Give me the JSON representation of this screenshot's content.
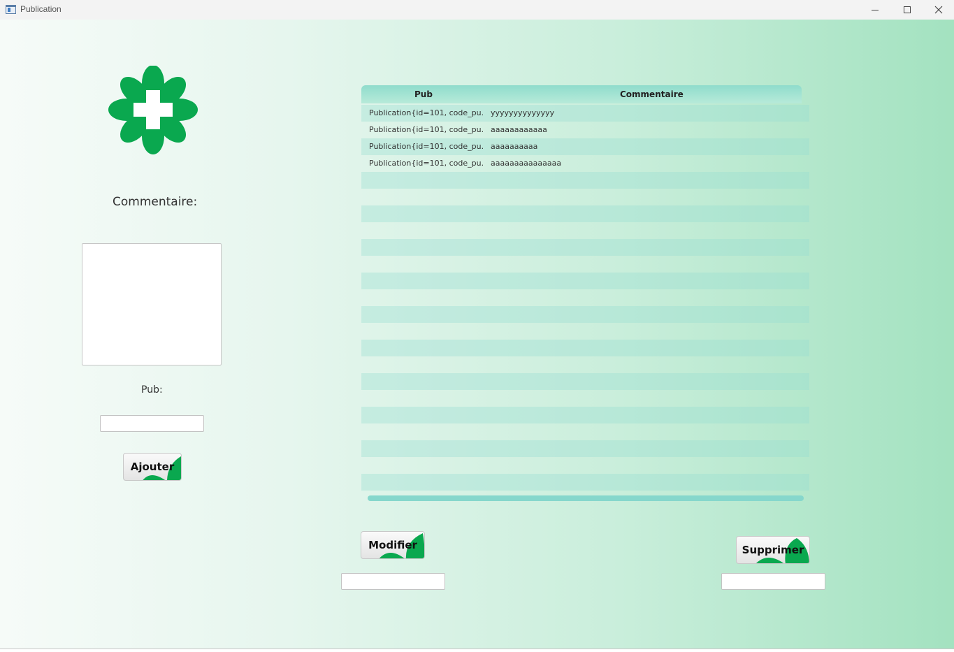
{
  "window": {
    "title": "Publication",
    "controls": {
      "minimize": "minimize",
      "maximize": "maximize",
      "close": "close"
    }
  },
  "form": {
    "comment_label": "Commentaire:",
    "comment_value": "",
    "pub_label": "Pub:",
    "pub_value": "",
    "add_button": "Ajouter"
  },
  "table": {
    "columns": [
      "Pub",
      "Commentaire"
    ],
    "rows": [
      {
        "pub": "Publication{id=101, code_pu...",
        "commentaire": "yyyyyyyyyyyyyy"
      },
      {
        "pub": "Publication{id=101, code_pu...",
        "commentaire": "aaaaaaaaaaaa"
      },
      {
        "pub": "Publication{id=101, code_pu...",
        "commentaire": "aaaaaaaaaa"
      },
      {
        "pub": "Publication{id=101, code_pu...",
        "commentaire": "aaaaaaaaaaaaaaa"
      }
    ]
  },
  "actions": {
    "modify_button": "Modifier",
    "modify_field_value": "",
    "delete_button": "Supprimer",
    "delete_field_value": ""
  },
  "colors": {
    "accent_green": "#0aa84f",
    "header_teal": "#8fdccc",
    "stripe": "#9ad9cf"
  },
  "icons": {
    "logo": "pharmacy-cross-flower-logo",
    "app": "window-app-icon"
  }
}
